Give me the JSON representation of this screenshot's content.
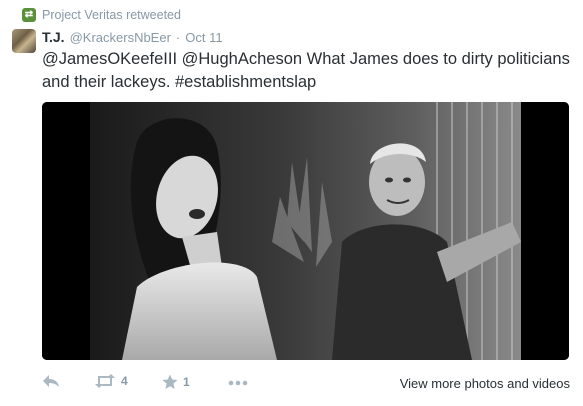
{
  "retweet_context": {
    "icon": "retweet-icon",
    "text": "Project Veritas retweeted"
  },
  "tweet": {
    "author_name": "T.J.",
    "author_handle": "@KrackersNbEer",
    "separator": "·",
    "date": "Oct 11",
    "text_line1": "@JamesOKeefeIII @HughAcheson What James does to dirty politicians",
    "text_line2": "and their lackeys.  #establishmentslap",
    "media_icon": "embedded-photo"
  },
  "actions": {
    "reply_icon": "reply-icon",
    "retweet_icon": "retweet-icon",
    "retweet_count": "4",
    "favorite_icon": "star-icon",
    "favorite_count": "1",
    "more_icon": "more-dots-icon",
    "view_more_label": "View more photos and videos"
  },
  "colors": {
    "text": "#292f33",
    "muted": "#8899a6",
    "retweet_green": "#5c913b",
    "action_icon": "#aab8c2"
  }
}
